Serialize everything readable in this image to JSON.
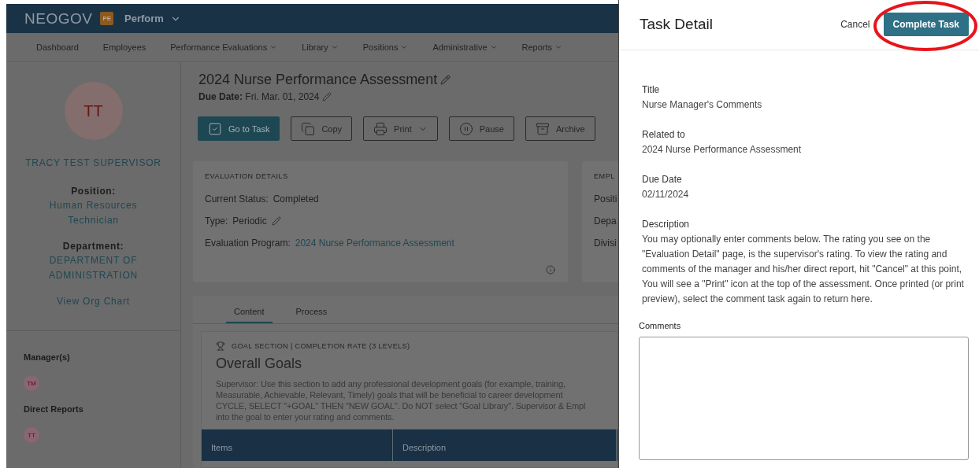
{
  "app": {
    "brand": "NEOGOV",
    "module_badge": "PE",
    "module": "Perform"
  },
  "nav": [
    {
      "label": "Dashboard",
      "dropdown": false
    },
    {
      "label": "Employees",
      "dropdown": false
    },
    {
      "label": "Performance Evaluations",
      "dropdown": true
    },
    {
      "label": "Library",
      "dropdown": true
    },
    {
      "label": "Positions",
      "dropdown": true
    },
    {
      "label": "Administrative",
      "dropdown": true
    },
    {
      "label": "Reports",
      "dropdown": true
    }
  ],
  "profile": {
    "initials": "TT",
    "name": "TRACY TEST SUPERVISOR",
    "position_label": "Position:",
    "position": "Human Resources Technician",
    "department_label": "Department:",
    "department": "DEPARTMENT OF ADMINISTRATION",
    "org_chart_link": "View Org Chart"
  },
  "relations": [
    {
      "heading": "Manager(s)",
      "people": [
        {
          "initials": "TM"
        }
      ]
    },
    {
      "heading": "Direct Reports",
      "people": [
        {
          "initials": "TT"
        }
      ]
    }
  ],
  "evaluation": {
    "title": "2024 Nurse Performance Assessment",
    "due_label": "Due Date:",
    "due_date": "Fri. Mar. 01, 2024"
  },
  "actions": [
    {
      "label": "Go to Task",
      "kind": "primary",
      "dropdown": false
    },
    {
      "label": "Copy",
      "kind": "outline",
      "dropdown": false
    },
    {
      "label": "Print",
      "kind": "outline",
      "dropdown": true
    },
    {
      "label": "Pause",
      "kind": "outline",
      "dropdown": false
    },
    {
      "label": "Archive",
      "kind": "outline",
      "dropdown": false
    }
  ],
  "details_card": {
    "heading": "EVALUATION DETAILS",
    "rows": [
      {
        "label": "Current Status:",
        "value": "Completed",
        "kind": "text"
      },
      {
        "label": "Type:",
        "value": "Periodic",
        "kind": "editable"
      },
      {
        "label": "Evaluation Program:",
        "value": "2024 Nurse Performance Assessment",
        "kind": "link"
      }
    ]
  },
  "employee_card": {
    "heading": "EMPL",
    "rows": [
      "Positi",
      "Depa",
      "Divisi"
    ]
  },
  "tabs": [
    {
      "label": "Content",
      "selected": true
    },
    {
      "label": "Process",
      "selected": false
    }
  ],
  "goal_section": {
    "eyebrow": "GOAL SECTION | COMPLETION RATE (3 LEVELS)",
    "title": "Overall Goals",
    "description_lines": [
      "Supervisor: Use this section to add any professional development goals (for example, training,",
      "Measurable, Achievable, Relevant, Timely) goals that will be beneficial to career development",
      "CYCLE, SELECT \"+GOAL\" THEN \"NEW GOAL\". Do NOT select \"Goal Library\". Supervisor & Empl",
      "into the goal to enter your rating and comments."
    ],
    "columns": [
      "Items",
      "Description"
    ]
  },
  "drawer": {
    "title": "Task Detail",
    "cancel": "Cancel",
    "submit": "Complete Task",
    "fields": [
      {
        "label": "Title",
        "value": "Nurse Manager's Comments"
      },
      {
        "label": "Related to",
        "value": "2024 Nurse Performance Assessment"
      },
      {
        "label": "Due Date",
        "value": "02/11/2024"
      },
      {
        "label": "Description",
        "value": "You may optionally enter comments below. The rating you see on the \"Evaluation Detail\" page, is the supervisor's rating. To view the rating and comments of the manager and his/her direct report, hit \"Cancel\" at this point, You will see a \"Print\" icon at the top of the assessment. Once printed (or print preview), select the comment task again to return here."
      }
    ],
    "comments": {
      "label": "Comments"
    }
  },
  "highlight": {
    "kind": "ellipse"
  }
}
